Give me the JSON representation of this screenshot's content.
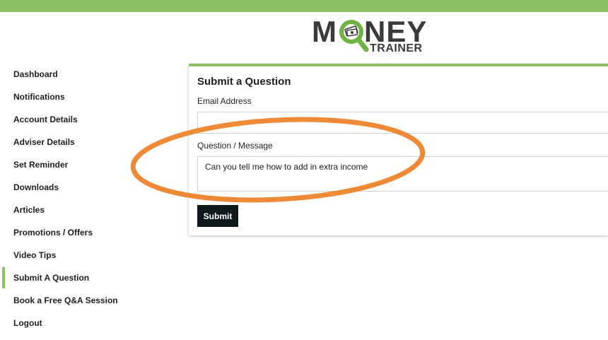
{
  "colors": {
    "accent": "#8cc063",
    "logo_text": "#3a3a3a",
    "logo_green": "#6cb33f",
    "button_bg": "#0f1a1c",
    "annotation": "#ee8a35"
  },
  "logo": {
    "word_prefix": "M",
    "word_suffix": "NEY",
    "subtitle": "TRAINER",
    "icon": "magnifier-money-icon"
  },
  "sidebar": {
    "items": [
      {
        "label": "Dashboard",
        "active": false
      },
      {
        "label": "Notifications",
        "active": false
      },
      {
        "label": "Account Details",
        "active": false
      },
      {
        "label": "Adviser Details",
        "active": false
      },
      {
        "label": "Set Reminder",
        "active": false
      },
      {
        "label": "Downloads",
        "active": false
      },
      {
        "label": "Articles",
        "active": false
      },
      {
        "label": "Promotions / Offers",
        "active": false
      },
      {
        "label": "Video Tips",
        "active": false
      },
      {
        "label": "Submit A Question",
        "active": true
      },
      {
        "label": "Book a Free Q&A Session",
        "active": false
      },
      {
        "label": "Logout",
        "active": false
      }
    ]
  },
  "form": {
    "title": "Submit a Question",
    "email_label": "Email Address",
    "email_value": "",
    "message_label": "Question / Message",
    "message_value": "Can you tell me how to add in extra income",
    "submit_label": "Submit"
  }
}
